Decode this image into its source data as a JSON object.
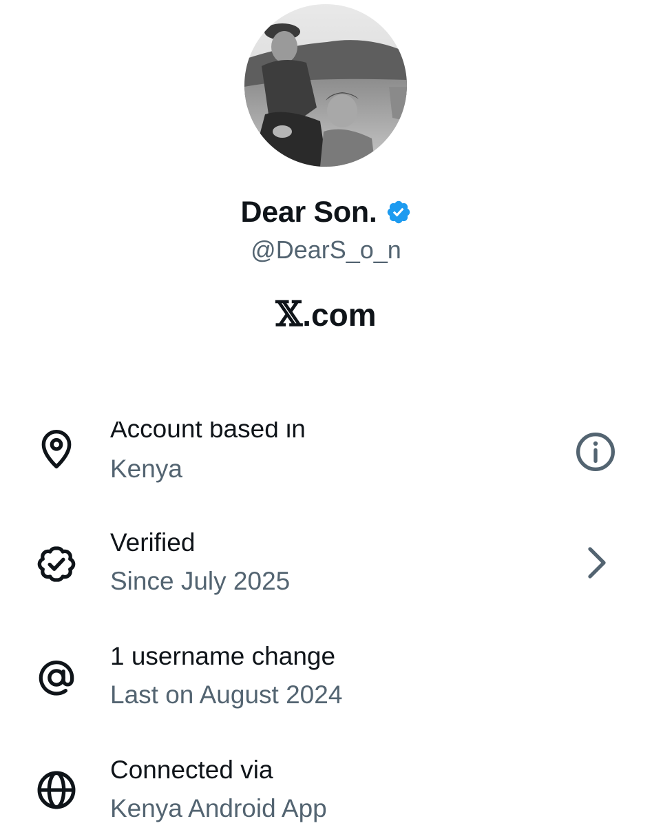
{
  "profile": {
    "display_name": "Dear Son.",
    "handle": "@DearS_o_n",
    "verified": true,
    "badge_color": "#1d9bf0",
    "avatar_alt": "profile photo"
  },
  "brand": {
    "glyph": "𝕏",
    "suffix": ".com"
  },
  "about_rows": [
    {
      "icon": "location-pin-icon",
      "title": "Account based in",
      "subtitle": "Kenya",
      "action_icon": "info-icon"
    },
    {
      "icon": "verified-badge-outline-icon",
      "title": "Verified",
      "subtitle": "Since July 2025",
      "action_icon": "chevron-right-icon"
    },
    {
      "icon": "at-sign-icon",
      "title": "1 username change",
      "subtitle": "Last on August 2024",
      "action_icon": ""
    },
    {
      "icon": "globe-icon",
      "title": "Connected via",
      "subtitle": "Kenya Android App",
      "action_icon": ""
    }
  ],
  "colors": {
    "text_primary": "#0f1419",
    "text_secondary": "#536471",
    "accent": "#1d9bf0"
  }
}
